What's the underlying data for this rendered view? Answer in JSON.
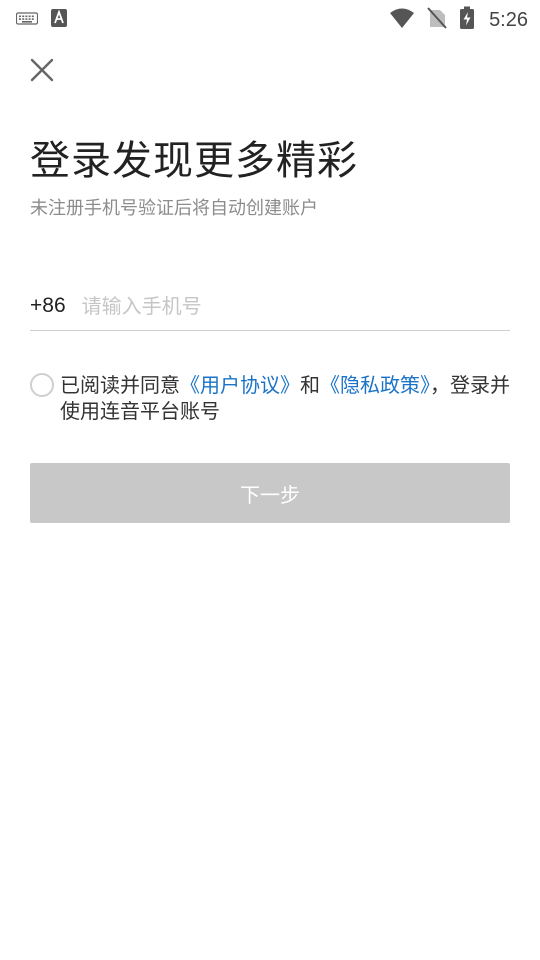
{
  "status_bar": {
    "time": "5:26",
    "icons": [
      "keyboard-icon",
      "font-a-icon",
      "wifi-icon",
      "no-sim-icon",
      "battery-charging-icon"
    ]
  },
  "header": {
    "close_icon": "close-icon"
  },
  "main": {
    "title": "登录发现更多精彩",
    "subtitle": "未注册手机号验证后将自动创建账户",
    "phone": {
      "country_code": "+86",
      "value": "",
      "placeholder": "请输入手机号"
    },
    "agreement": {
      "prefix": "已阅读并同意",
      "user_agreement_link": "《用户协议》",
      "and": "和",
      "privacy_link": "《隐私政策》",
      "suffix": "，登录并使用连音平台账号",
      "checked": false
    },
    "next_button": "下一步",
    "next_button_color": "#c8c8c8",
    "link_color": "#1a73c8"
  }
}
